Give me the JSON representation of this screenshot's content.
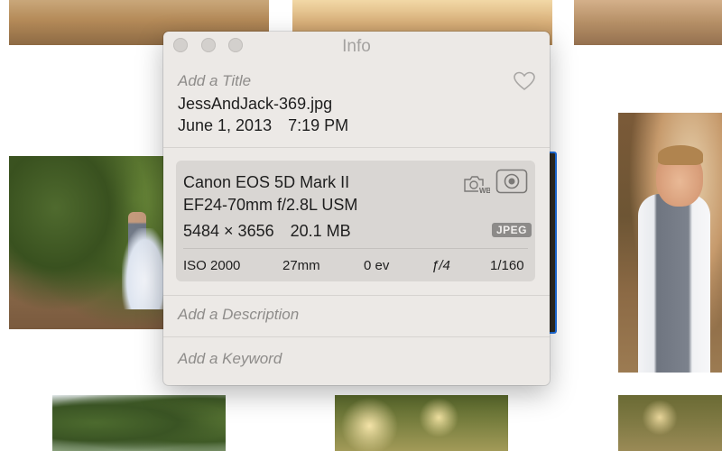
{
  "window": {
    "title": "Info"
  },
  "metadata": {
    "title_placeholder": "Add a Title",
    "filename": "JessAndJack-369.jpg",
    "date": "June 1, 2013",
    "time": "7:19 PM"
  },
  "exif": {
    "camera": "Canon EOS 5D Mark II",
    "lens": "EF24-70mm f/2.8L USM",
    "dimensions": "5484 × 3656",
    "filesize": "20.1 MB",
    "format_badge": "JPEG",
    "wb_label": "WB",
    "iso": "ISO 2000",
    "focal_length": "27mm",
    "exposure_bias": "0 ev",
    "aperture": "ƒ/4",
    "shutter": "1/160"
  },
  "description": {
    "placeholder": "Add a Description"
  },
  "keyword": {
    "placeholder": "Add a Keyword"
  },
  "icons": {
    "favorite": "heart-icon",
    "white_balance": "camera-wb-icon",
    "metering": "metering-mode-icon"
  },
  "colors": {
    "panel_bg": "#ece9e6",
    "exif_card_bg": "#d9d6d3",
    "selection_accent": "#1d6fe0",
    "placeholder_text": "#8e8c8a"
  }
}
